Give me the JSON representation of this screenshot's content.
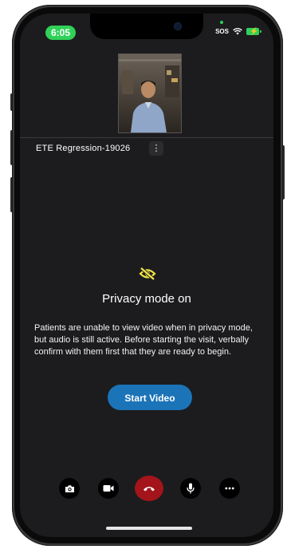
{
  "status_bar": {
    "time": "6:05",
    "sos": "SOS"
  },
  "meeting": {
    "title": "ETE Regression-19026",
    "more_options_icon": "kebab-icon"
  },
  "privacy": {
    "icon": "eye-slash-icon",
    "heading": "Privacy mode on",
    "body": "Patients are unable to view video when in privacy mode, but audio is still active. Before starting the visit, verbally confirm with them first that they are ready to begin.",
    "start_video_label": "Start Video"
  },
  "controls": [
    {
      "name": "switch-camera-button",
      "icon": "camera-icon"
    },
    {
      "name": "video-button",
      "icon": "video-camera-icon"
    },
    {
      "name": "end-call-button",
      "icon": "phone-hangup-icon"
    },
    {
      "name": "microphone-button",
      "icon": "microphone-icon"
    },
    {
      "name": "more-button",
      "icon": "ellipsis-icon"
    }
  ],
  "colors": {
    "screen_bg": "#1c1c1e",
    "accent_blue": "#1b74b8",
    "end_call_red": "#a3141b",
    "privacy_icon_yellow": "#f2e64a",
    "status_green": "#30d158"
  }
}
